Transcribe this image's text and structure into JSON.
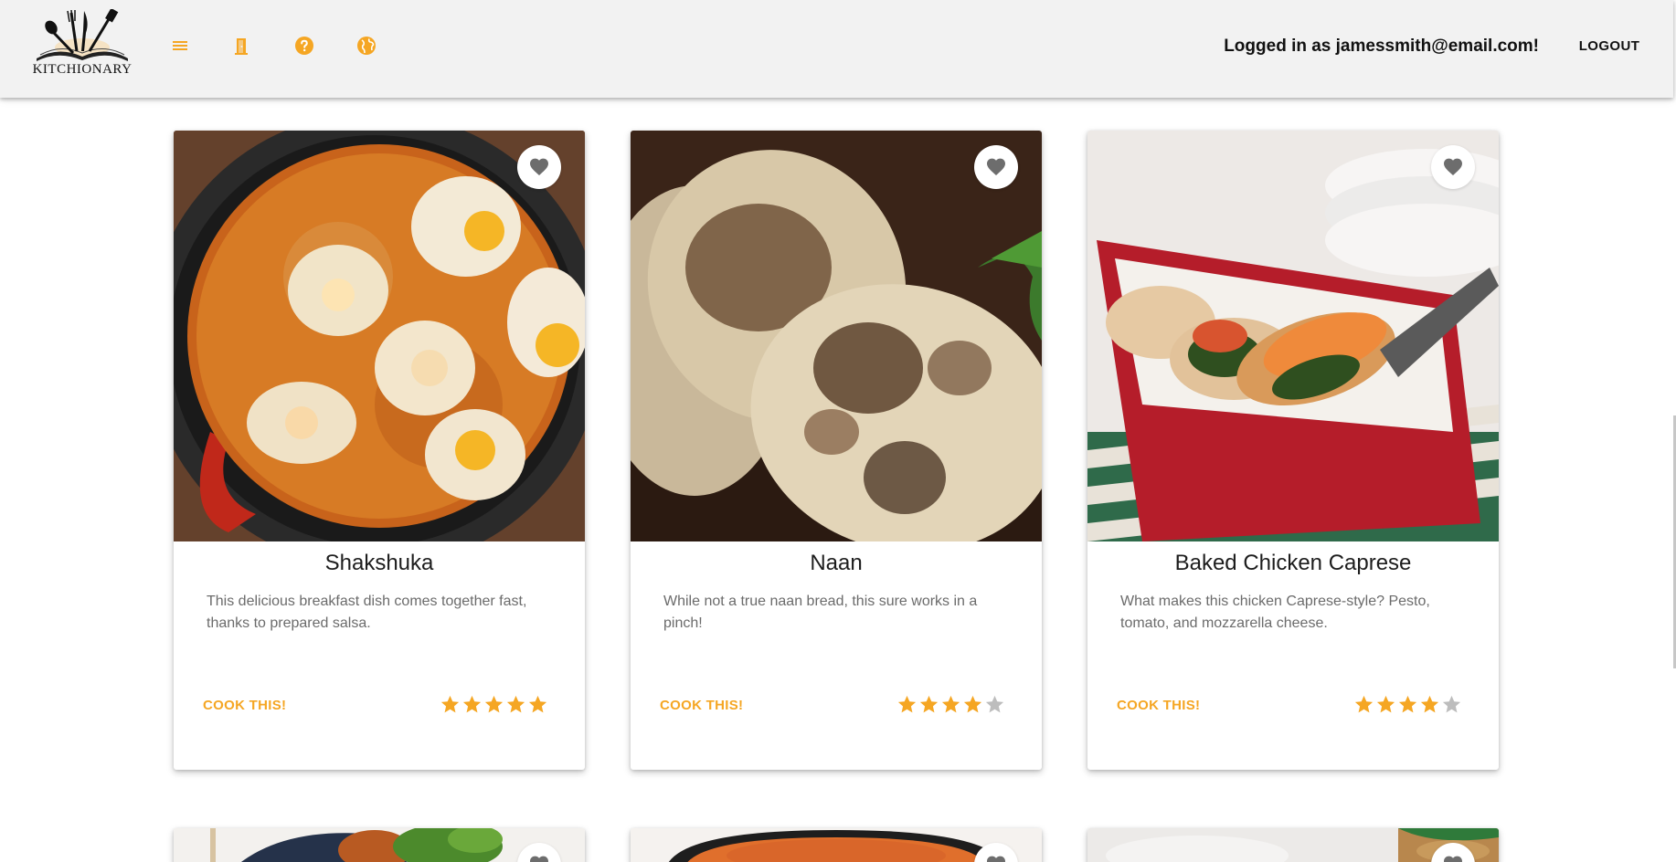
{
  "header": {
    "logo_text": "KITCHIONARY",
    "user_text": "Logged in as jamessmith@email.com!",
    "logout_label": "LOGOUT",
    "icons": [
      "menu-icon",
      "door-icon",
      "help-icon",
      "globe-icon"
    ],
    "icon_color": "#f5a623"
  },
  "theme": {
    "accent": "#f5a623",
    "star_filled": "#f5a623",
    "star_empty": "#bdbdbd",
    "heart": "#6d6d6d",
    "header_bg": "#f2f2f2"
  },
  "recipes": [
    {
      "title": "Shakshuka",
      "description": "This delicious breakfast dish comes together fast, thanks to prepared salsa.",
      "cta": "COOK THIS!",
      "rating": 5,
      "rating_max": 5
    },
    {
      "title": "Naan",
      "description": "While not a true naan bread, this sure works in a pinch!",
      "cta": "COOK THIS!",
      "rating": 4,
      "rating_max": 5
    },
    {
      "title": "Baked Chicken Caprese",
      "description": "What makes this chicken Caprese-style? Pesto, tomato, and mozzarella cheese.",
      "cta": "COOK THIS!",
      "rating": 4,
      "rating_max": 5
    }
  ]
}
